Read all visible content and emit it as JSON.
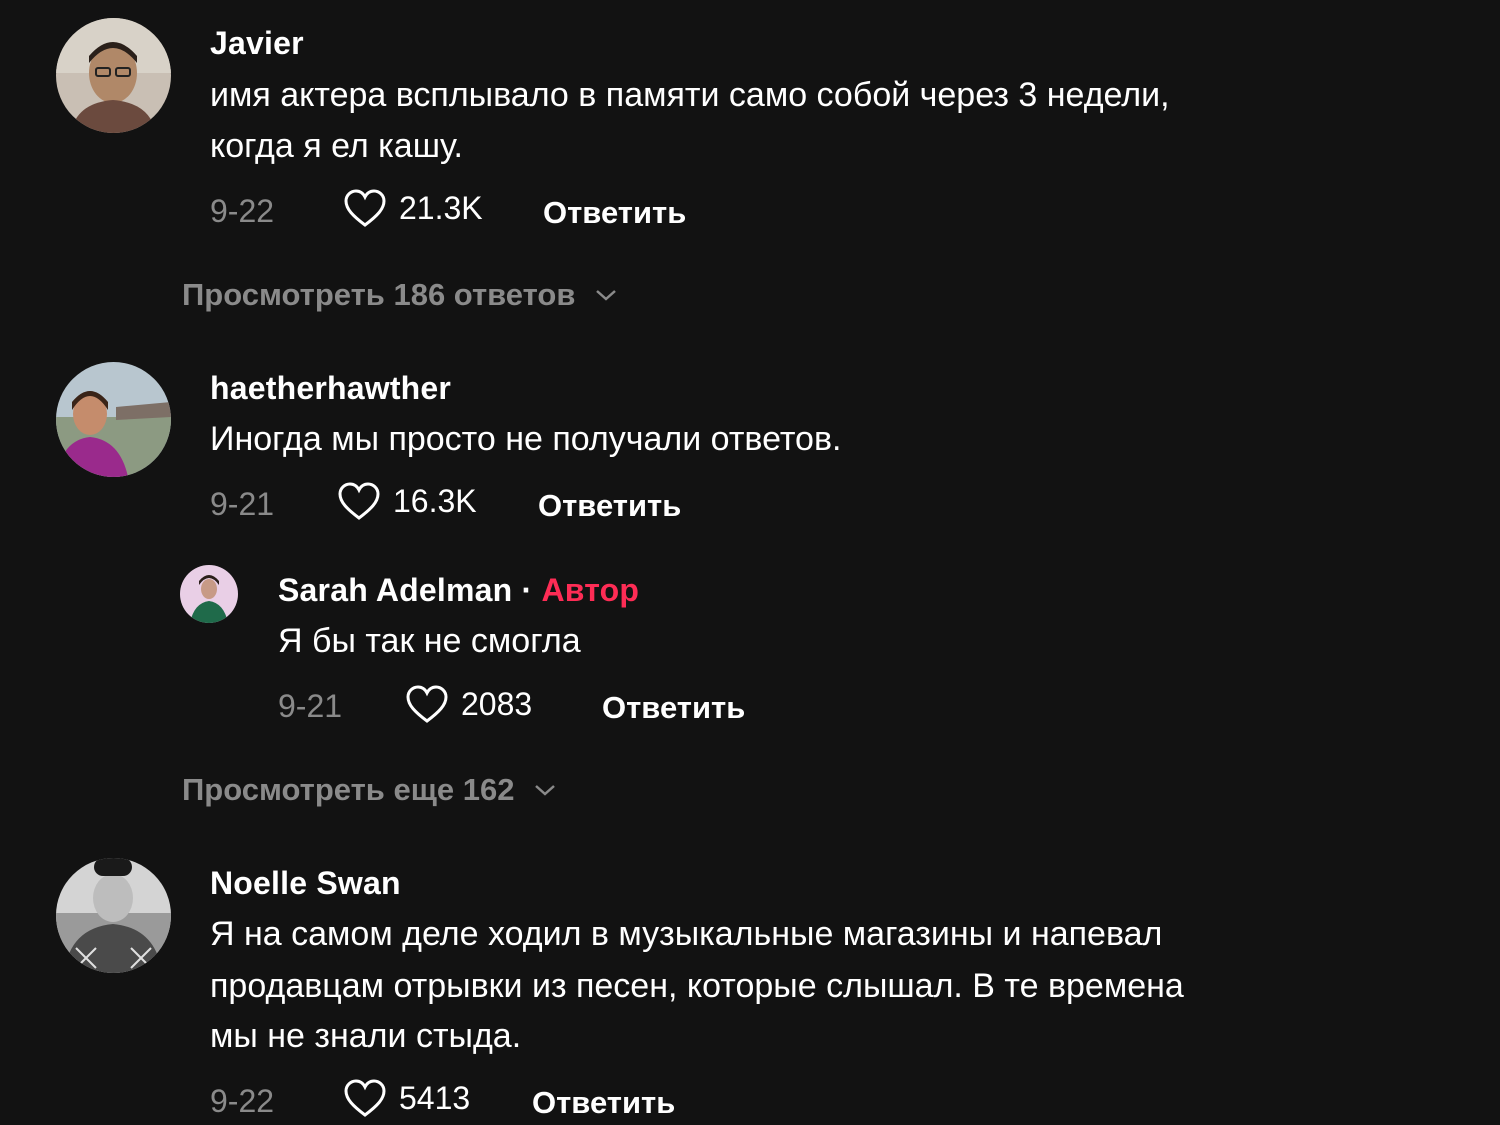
{
  "comments": [
    {
      "username": "Javier",
      "text_lines": [
        "имя актера всплывало в памяти само собой через 3 недели,",
        "когда я ел кашу."
      ],
      "date": "9-22",
      "likes": "21.3K",
      "reply_label": "Ответить",
      "view_replies": "Просмотреть 186 ответов"
    },
    {
      "username": "haetherhawther",
      "text_lines": [
        "Иногда мы просто не получали ответов."
      ],
      "date": "9-21",
      "likes": "16.3K",
      "reply_label": "Ответить",
      "reply": {
        "username": "Sarah Adelman",
        "separator": "·",
        "author_badge": "Автор",
        "text": "Я бы так не смогла",
        "date": "9-21",
        "likes": "2083",
        "reply_label": "Ответить"
      },
      "view_replies": "Просмотреть еще 162"
    },
    {
      "username": "Noelle Swan",
      "text_lines": [
        "Я на самом деле ходил в музыкальные магазины и напевал",
        "продавцам отрывки из песен, которые слышал. В те времена",
        "мы не знали стыда."
      ],
      "date": "9-22",
      "likes": "5413",
      "reply_label": "Ответить"
    }
  ],
  "colors": {
    "background": "#121212",
    "author_accent": "#fe2c55",
    "muted": "#8a8a8a"
  },
  "icons": {
    "like": "heart-outline-icon",
    "expand": "chevron-down-icon"
  }
}
